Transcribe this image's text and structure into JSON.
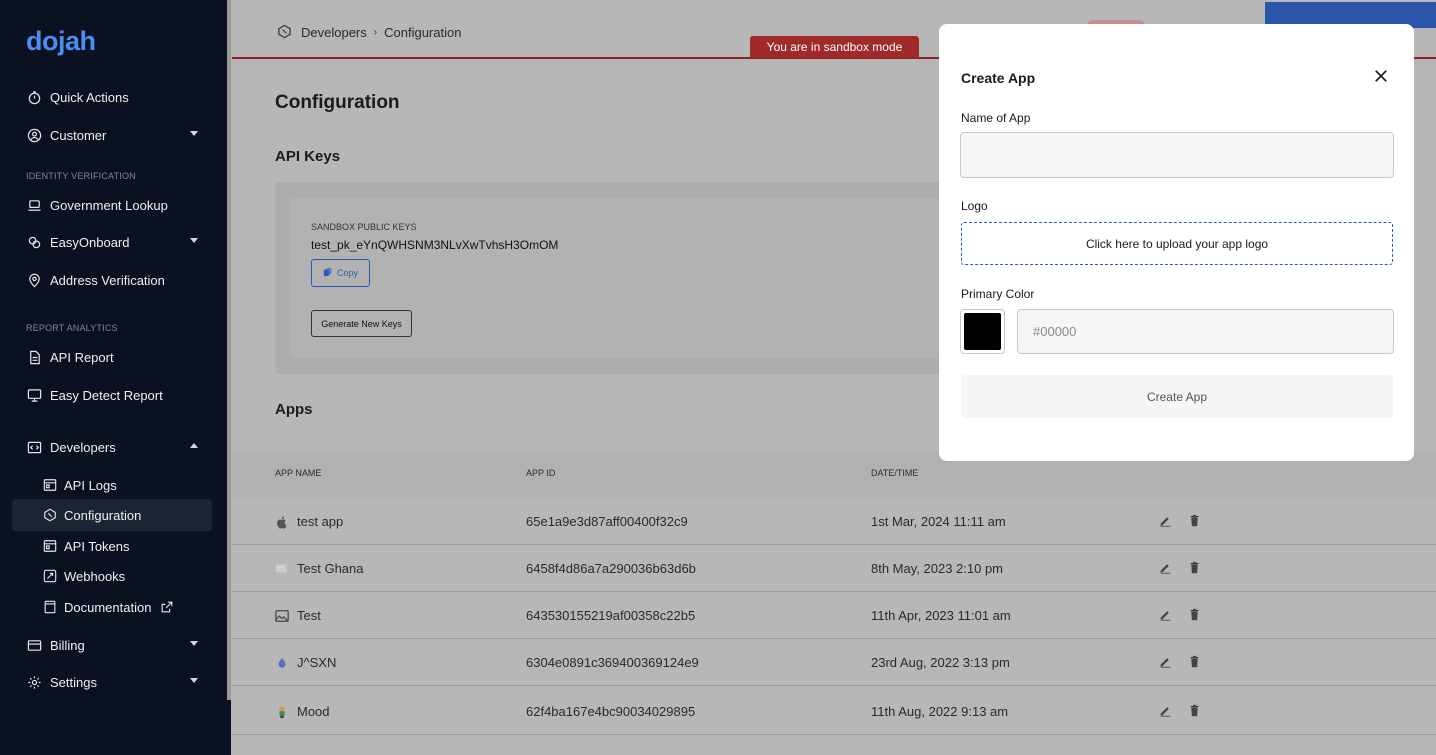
{
  "sidebar": {
    "logo": "dojah",
    "items": {
      "quick_actions": "Quick Actions",
      "customer": "Customer",
      "section_identity": "IDENTITY VERIFICATION",
      "government_lookup": "Government Lookup",
      "easy_onboard": "EasyOnboard",
      "address_verification": "Address Verification",
      "section_report": "REPORT ANALYTICS",
      "api_report": "API Report",
      "easy_detect_report": "Easy Detect Report",
      "developers": "Developers",
      "api_logs": "API Logs",
      "configuration": "Configuration",
      "api_tokens": "API Tokens",
      "webhooks": "Webhooks",
      "documentation": "Documentation",
      "billing": "Billing",
      "settings": "Settings"
    }
  },
  "header": {
    "breadcrumb": [
      "Developers",
      "Configuration"
    ],
    "sandbox_banner": "You are in sandbox mode"
  },
  "main": {
    "title": "Configuration",
    "api_keys": {
      "heading": "API Keys",
      "label": "SANDBOX PUBLIC KEYS",
      "value": "test_pk_eYnQWHSNM3NLvXwTvhsH3OmOM",
      "copy_label": "Copy",
      "generate_label": "Generate New Keys"
    },
    "apps": {
      "heading": "Apps",
      "columns": [
        "APP NAME",
        "APP ID",
        "DATE/TIME"
      ],
      "rows": [
        {
          "name": "test app",
          "id": "65e1a9e3d87aff00400f32c9",
          "date": "1st Mar, 2024 11:11 am"
        },
        {
          "name": "Test Ghana",
          "id": "6458f4d86a7a290036b63d6b",
          "date": "8th May, 2023 2:10 pm"
        },
        {
          "name": "Test",
          "id": "643530155219af00358c22b5",
          "date": "11th Apr, 2023 11:01 am"
        },
        {
          "name": "J^SXN",
          "id": "6304e0891c369400369124e9",
          "date": "23rd Aug, 2022 3:13 pm"
        },
        {
          "name": "Mood",
          "id": "62f4ba167e4bc90034029895",
          "date": "11th Aug, 2022 9:13 am"
        }
      ]
    }
  },
  "modal": {
    "title": "Create App",
    "name_label": "Name of App",
    "name_value": "",
    "logo_label": "Logo",
    "upload_text": "Click here to upload your app logo",
    "color_label": "Primary Color",
    "color_placeholder": "#00000",
    "swatch_color": "#000000",
    "submit_label": "Create App"
  },
  "colors": {
    "sidebar_bg": "#0b1120",
    "accent_blue": "#2b5bb5",
    "sandbox_red": "#a02a2a"
  }
}
